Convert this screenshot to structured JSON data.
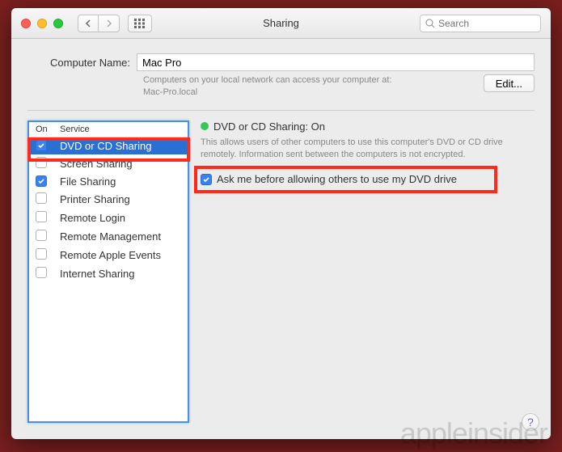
{
  "window": {
    "title": "Sharing"
  },
  "search": {
    "placeholder": "Search"
  },
  "computer_name": {
    "label": "Computer Name:",
    "value": "Mac Pro",
    "description_line1": "Computers on your local network can access your computer at:",
    "description_line2": "Mac-Pro.local",
    "edit_button": "Edit..."
  },
  "services": {
    "header_on": "On",
    "header_service": "Service",
    "items": [
      {
        "label": "DVD or CD Sharing",
        "checked": true,
        "selected": true
      },
      {
        "label": "Screen Sharing",
        "checked": false,
        "selected": false
      },
      {
        "label": "File Sharing",
        "checked": true,
        "selected": false
      },
      {
        "label": "Printer Sharing",
        "checked": false,
        "selected": false
      },
      {
        "label": "Remote Login",
        "checked": false,
        "selected": false
      },
      {
        "label": "Remote Management",
        "checked": false,
        "selected": false
      },
      {
        "label": "Remote Apple Events",
        "checked": false,
        "selected": false
      },
      {
        "label": "Internet Sharing",
        "checked": false,
        "selected": false
      }
    ]
  },
  "detail": {
    "status_dot_color": "#35c759",
    "status_label": "DVD or CD Sharing: On",
    "info": "This allows users of other computers to use this computer's DVD or CD drive remotely. Information sent between the computers is not encrypted.",
    "ask_checkbox_label": "Ask me before allowing others to use my DVD drive",
    "ask_checked": true
  },
  "annotations": {
    "highlight_1": "Red callout highlighting the selected service row",
    "highlight_2": "Red callout highlighting the ask-before-allowing checkbox"
  },
  "watermark": "appleinsider"
}
